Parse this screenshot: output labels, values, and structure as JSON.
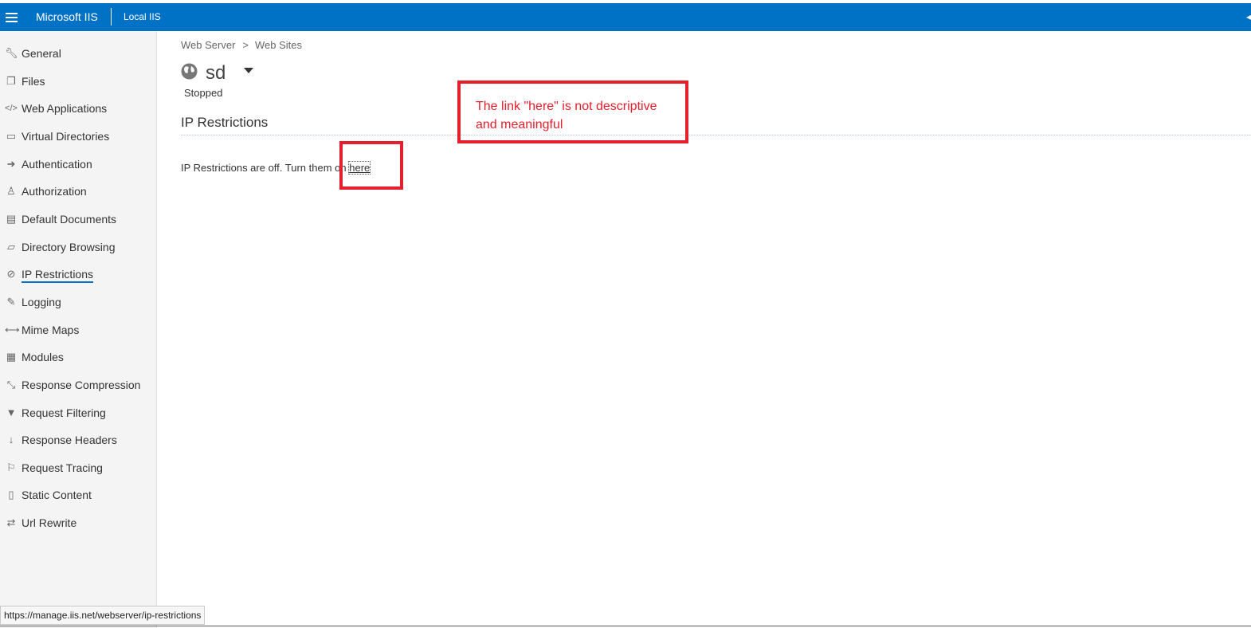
{
  "topbar": {
    "brand": "Microsoft IIS",
    "server": "Local IIS"
  },
  "sidebar": {
    "items": [
      {
        "label": "General",
        "icon": "wrench-icon"
      },
      {
        "label": "Files",
        "icon": "files-icon"
      },
      {
        "label": "Web Applications",
        "icon": "code-icon"
      },
      {
        "label": "Virtual Directories",
        "icon": "folder-icon"
      },
      {
        "label": "Authentication",
        "icon": "sign-in-icon"
      },
      {
        "label": "Authorization",
        "icon": "user-icon"
      },
      {
        "label": "Default Documents",
        "icon": "document-icon"
      },
      {
        "label": "Directory Browsing",
        "icon": "folder-open-icon"
      },
      {
        "label": "IP Restrictions",
        "icon": "ban-icon",
        "active": true
      },
      {
        "label": "Logging",
        "icon": "pencil-icon"
      },
      {
        "label": "Mime Maps",
        "icon": "arrows-h-icon"
      },
      {
        "label": "Modules",
        "icon": "grid-icon"
      },
      {
        "label": "Response Compression",
        "icon": "compress-icon"
      },
      {
        "label": "Request Filtering",
        "icon": "filter-icon"
      },
      {
        "label": "Response Headers",
        "icon": "arrow-down-icon"
      },
      {
        "label": "Request Tracing",
        "icon": "flag-icon"
      },
      {
        "label": "Static Content",
        "icon": "file-icon"
      },
      {
        "label": "Url Rewrite",
        "icon": "exchange-icon"
      }
    ]
  },
  "breadcrumb": {
    "root": "Web Server",
    "separator": ">",
    "current": "Web Sites"
  },
  "site": {
    "name": "sd",
    "status": "Stopped"
  },
  "section": {
    "title": "IP Restrictions",
    "message_prefix": "IP Restrictions are off. Turn them on ",
    "link_text": "here"
  },
  "annotation": {
    "text": "The link \"here\" is not descriptive and meaningful",
    "color": "#e3202b"
  },
  "status_bar": {
    "url": "https://manage.iis.net/webserver/ip-restrictions"
  },
  "colors": {
    "accent": "#0072c6",
    "sidebar_bg": "#f4f4f4"
  }
}
